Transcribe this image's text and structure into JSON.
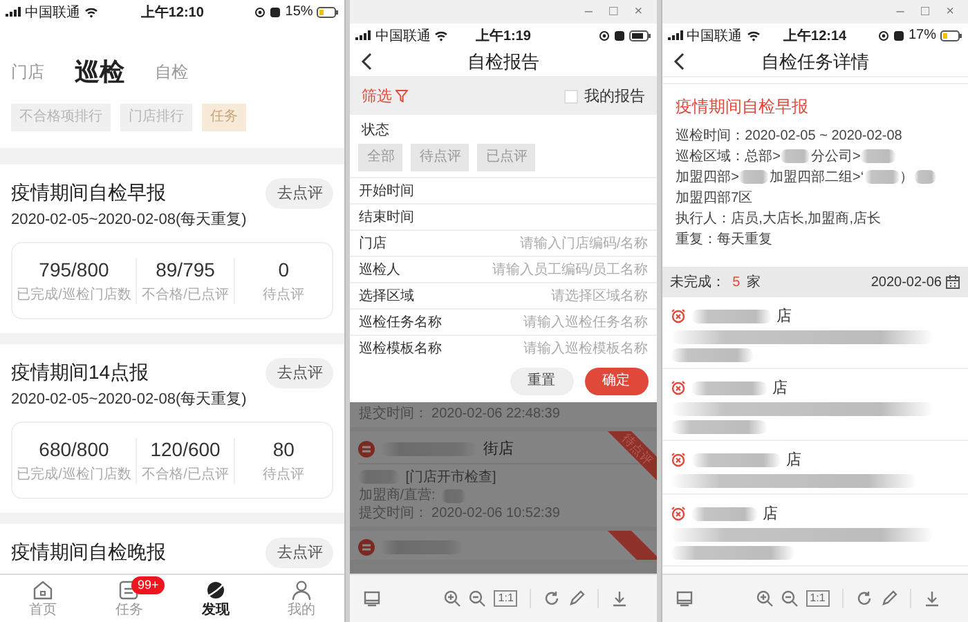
{
  "left_phone": {
    "status_bar": {
      "carrier": "中国联通",
      "time": "上午12:10",
      "battery": "15%"
    },
    "top_tabs": [
      {
        "label": "门店",
        "selected": false
      },
      {
        "label": "巡检",
        "selected": true
      },
      {
        "label": "自检",
        "selected": false
      }
    ],
    "filter_chips": [
      {
        "label": "不合格项排行",
        "selected": false
      },
      {
        "label": "门店排行",
        "selected": false
      },
      {
        "label": "任务",
        "selected": true
      }
    ],
    "reports": [
      {
        "title": "疫情期间自检早报",
        "dates": "2020-02-05~2020-02-08(每天重复)",
        "action": "去点评",
        "stats": [
          {
            "value": "795/800",
            "label": "已完成/巡检门店数"
          },
          {
            "value": "89/795",
            "label": "不合格/已点评"
          },
          {
            "value": "0",
            "label": "待点评"
          }
        ]
      },
      {
        "title": "疫情期间14点报",
        "dates": "2020-02-05~2020-02-08(每天重复)",
        "action": "去点评",
        "stats": [
          {
            "value": "680/800",
            "label": "已完成/巡检门店数"
          },
          {
            "value": "120/600",
            "label": "不合格/已点评"
          },
          {
            "value": "80",
            "label": "待点评"
          }
        ]
      },
      {
        "title": "疫情期间自检晚报",
        "action": "去点评"
      }
    ],
    "tab_bar": [
      {
        "kind": "home",
        "label": "首页",
        "selected": false
      },
      {
        "kind": "task",
        "label": "任务",
        "selected": false,
        "badge": "99+"
      },
      {
        "kind": "discover",
        "label": "发现",
        "selected": true
      },
      {
        "kind": "profile",
        "label": "我的",
        "selected": false
      }
    ]
  },
  "report_window": {
    "window_buttons": [
      "–",
      "□",
      "×"
    ],
    "status_bar": {
      "carrier": "中国联通",
      "time": "上午1:19"
    },
    "title": "自检报告",
    "filter": {
      "label": "筛选",
      "my_reports": {
        "label": "我的报告",
        "checked": false
      }
    },
    "status": {
      "label": "状态",
      "options": [
        {
          "label": "全部",
          "selected": false
        },
        {
          "label": "待点评",
          "selected": false
        },
        {
          "label": "已点评",
          "selected": false
        }
      ]
    },
    "fields": [
      {
        "label": "开始时间"
      },
      {
        "label": "结束时间"
      },
      {
        "label": "门店",
        "placeholder": "请输入门店编码/名称"
      },
      {
        "label": "巡检人",
        "placeholder": "请输入员工编码/员工名称"
      },
      {
        "label": "选择区域",
        "placeholder": "请选择区域名称"
      },
      {
        "label": "巡检任务名称",
        "placeholder": "请输入巡检任务名称"
      },
      {
        "label": "巡检模板名称",
        "placeholder": "请输入巡检模板名称"
      }
    ],
    "buttons": [
      {
        "label": "重置",
        "kind": "secondary"
      },
      {
        "label": "确定",
        "kind": "primary"
      }
    ],
    "list": [
      {
        "kind": "tail",
        "submitted": "提交时间： 2020-02-06 22:48:39"
      },
      {
        "kind": "full",
        "store": "街店",
        "ribbon": "待点评",
        "template": "[门店开市检查]",
        "owner": "加盟商/直营:",
        "submitted": "提交时间： 2020-02-06 10:52:39"
      },
      {
        "kind": "head"
      }
    ],
    "toolbar": {
      "actual_size": "1:1"
    }
  },
  "detail_window": {
    "window_buttons": [
      "–",
      "□",
      "×"
    ],
    "status_bar": {
      "carrier": "中国联通",
      "time": "上午12:14",
      "battery": "17%"
    },
    "title": "自检任务详情",
    "task": {
      "title": "疫情期间自检早报",
      "time": "巡检时间：2020-02-05 ~ 2020-02-08",
      "region_label": "巡检区域：",
      "region_parts": [
        "总部>",
        "分公司>",
        "加盟四部>",
        "加盟四部二组>‘",
        "）",
        "加盟四部7区"
      ],
      "executors": "执行人：店员,大店长,加盟商,店长",
      "repeat": "重复：每天重复"
    },
    "summary": {
      "label": "未完成：",
      "count": "5",
      "unit": "家",
      "date": "2020-02-06"
    },
    "stores": [
      {
        "suffix": "店",
        "kind": "long"
      },
      {
        "suffix": "店",
        "kind": "long"
      },
      {
        "suffix": "店",
        "kind": "short"
      },
      {
        "suffix": "店",
        "kind": "long"
      }
    ],
    "toolbar": {
      "actual_size": "1:1"
    }
  }
}
